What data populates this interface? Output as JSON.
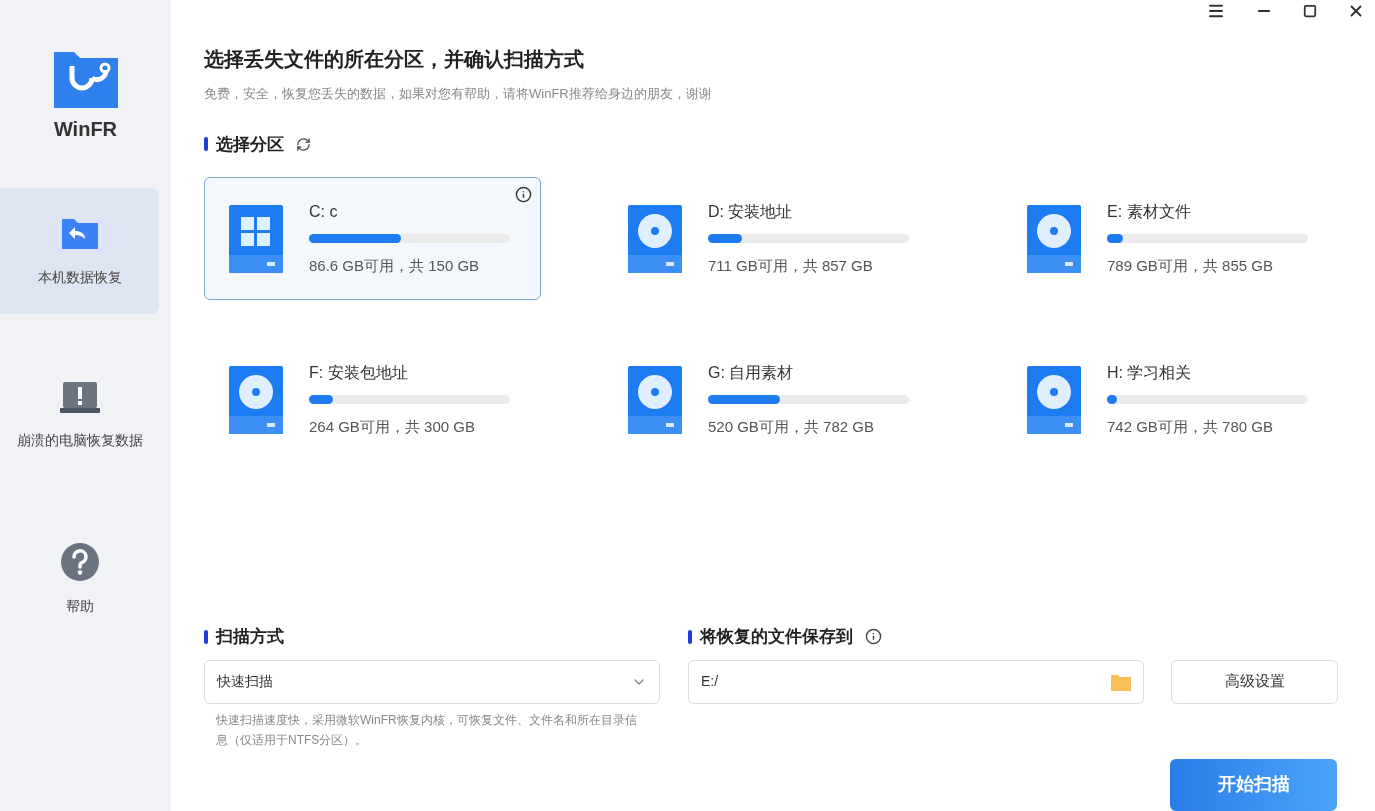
{
  "app": {
    "name": "WinFR"
  },
  "sidebar": {
    "items": [
      {
        "label": "本机数据恢复",
        "kind": "folder",
        "selected": true
      },
      {
        "label": "崩溃的电脑恢复数据",
        "kind": "laptop",
        "selected": false
      },
      {
        "label": "帮助",
        "kind": "help",
        "selected": false
      }
    ]
  },
  "header": {
    "title": "选择丢失文件的所在分区，并确认扫描方式",
    "subtitle": "免费，安全，恢复您丢失的数据，如果对您有帮助，请将WinFR推荐给身边的朋友，谢谢"
  },
  "partitions": {
    "title": "选择分区",
    "items": [
      {
        "name": "C: c",
        "kind": "system",
        "level": 0.46,
        "usage": "86.6 GB可用，共 150 GB",
        "selected": true
      },
      {
        "name": "D: 安装地址",
        "kind": "disk",
        "level": 0.17,
        "usage": "711 GB可用，共 857 GB",
        "selected": false
      },
      {
        "name": "E: 素材文件",
        "kind": "disk",
        "level": 0.08,
        "usage": "789 GB可用，共 855 GB",
        "selected": false
      },
      {
        "name": "F: 安装包地址",
        "kind": "disk",
        "level": 0.12,
        "usage": "264 GB可用，共 300 GB",
        "selected": false
      },
      {
        "name": "G: 自用素材",
        "kind": "disk",
        "level": 0.36,
        "usage": "520 GB可用，共 782 GB",
        "selected": false
      },
      {
        "name": "H: 学习相关",
        "kind": "disk",
        "level": 0.05,
        "usage": "742 GB可用，共 780 GB",
        "selected": false
      }
    ]
  },
  "scan_mode": {
    "title": "扫描方式",
    "value": "快速扫描",
    "description": "快速扫描速度快，采用微软WinFR恢复内核，可恢复文件、文件名和所在目录信息（仅适用于NTFS分区）。"
  },
  "save_to": {
    "title": "将恢复的文件保存到",
    "value": "E:/"
  },
  "advanced_button": "高级设置",
  "start_button": "开始扫描"
}
